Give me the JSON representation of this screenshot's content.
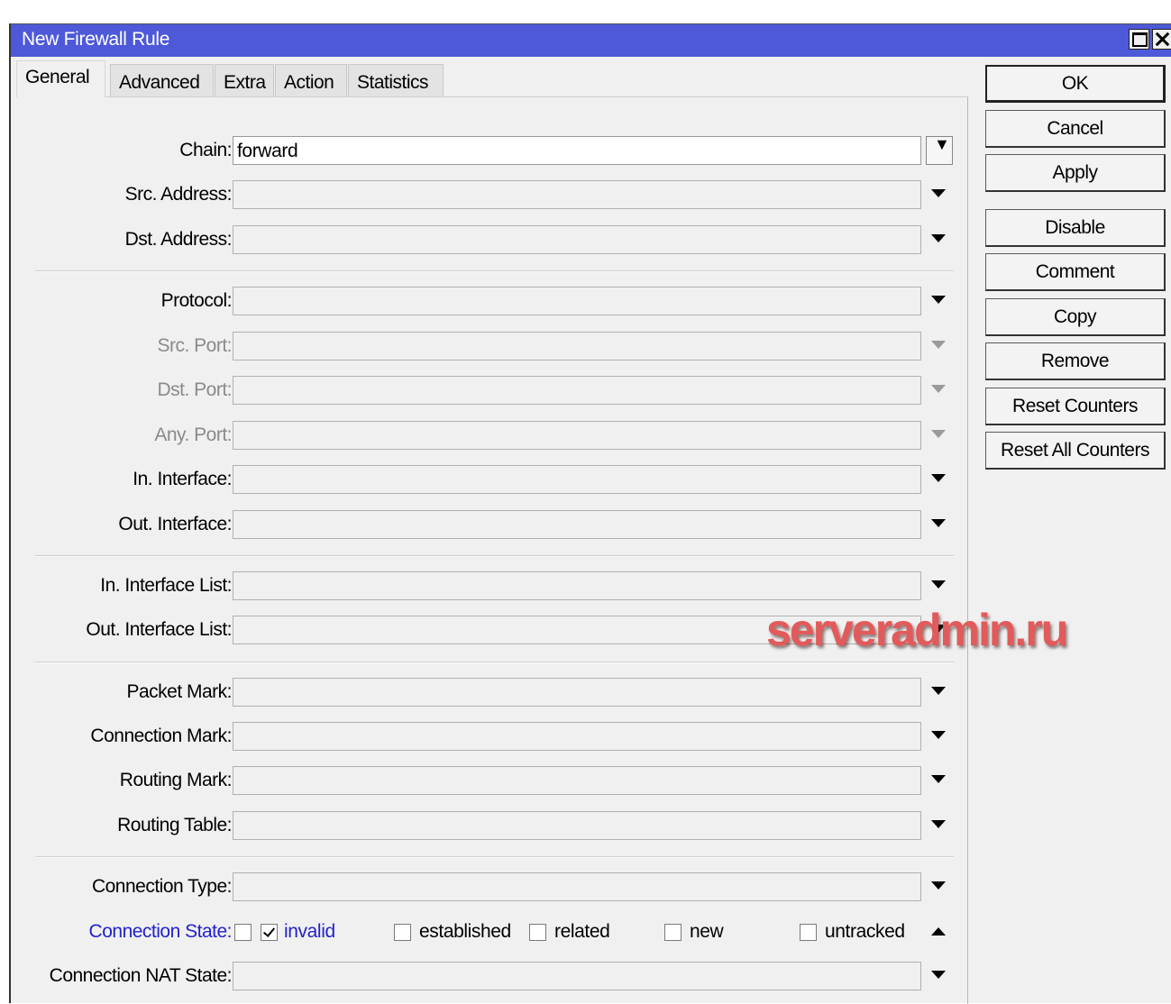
{
  "window": {
    "title": "New Firewall Rule"
  },
  "tabs": [
    "General",
    "Advanced",
    "Extra",
    "Action",
    "Statistics"
  ],
  "fields": {
    "chain": {
      "label": "Chain:",
      "value": "forward"
    },
    "src_address": {
      "label": "Src. Address:",
      "value": ""
    },
    "dst_address": {
      "label": "Dst. Address:",
      "value": ""
    },
    "protocol": {
      "label": "Protocol:",
      "value": ""
    },
    "src_port": {
      "label": "Src. Port:",
      "value": ""
    },
    "dst_port": {
      "label": "Dst. Port:",
      "value": ""
    },
    "any_port": {
      "label": "Any. Port:",
      "value": ""
    },
    "in_interface": {
      "label": "In. Interface:",
      "value": ""
    },
    "out_interface": {
      "label": "Out. Interface:",
      "value": ""
    },
    "in_interface_list": {
      "label": "In. Interface List:",
      "value": ""
    },
    "out_interface_list": {
      "label": "Out. Interface List:",
      "value": ""
    },
    "packet_mark": {
      "label": "Packet Mark:",
      "value": ""
    },
    "connection_mark": {
      "label": "Connection Mark:",
      "value": ""
    },
    "routing_mark": {
      "label": "Routing Mark:",
      "value": ""
    },
    "routing_table": {
      "label": "Routing Table:",
      "value": ""
    },
    "connection_type": {
      "label": "Connection Type:",
      "value": ""
    },
    "connection_nat_state": {
      "label": "Connection NAT State:",
      "value": ""
    }
  },
  "connection_state": {
    "label": "Connection State:",
    "negate_checked": false,
    "options": [
      {
        "label": "invalid",
        "checked": true
      },
      {
        "label": "established",
        "checked": false
      },
      {
        "label": "related",
        "checked": false
      },
      {
        "label": "new",
        "checked": false
      },
      {
        "label": "untracked",
        "checked": false
      }
    ]
  },
  "buttons": {
    "ok": "OK",
    "cancel": "Cancel",
    "apply": "Apply",
    "disable": "Disable",
    "comment": "Comment",
    "copy": "Copy",
    "remove": "Remove",
    "reset_counters": "Reset Counters",
    "reset_all_counters": "Reset All Counters"
  },
  "watermark": "serveradmin.ru",
  "colors": {
    "titlebar": "#4d59d8",
    "highlight_label": "#2222cc",
    "watermark": "#e35a5a"
  }
}
